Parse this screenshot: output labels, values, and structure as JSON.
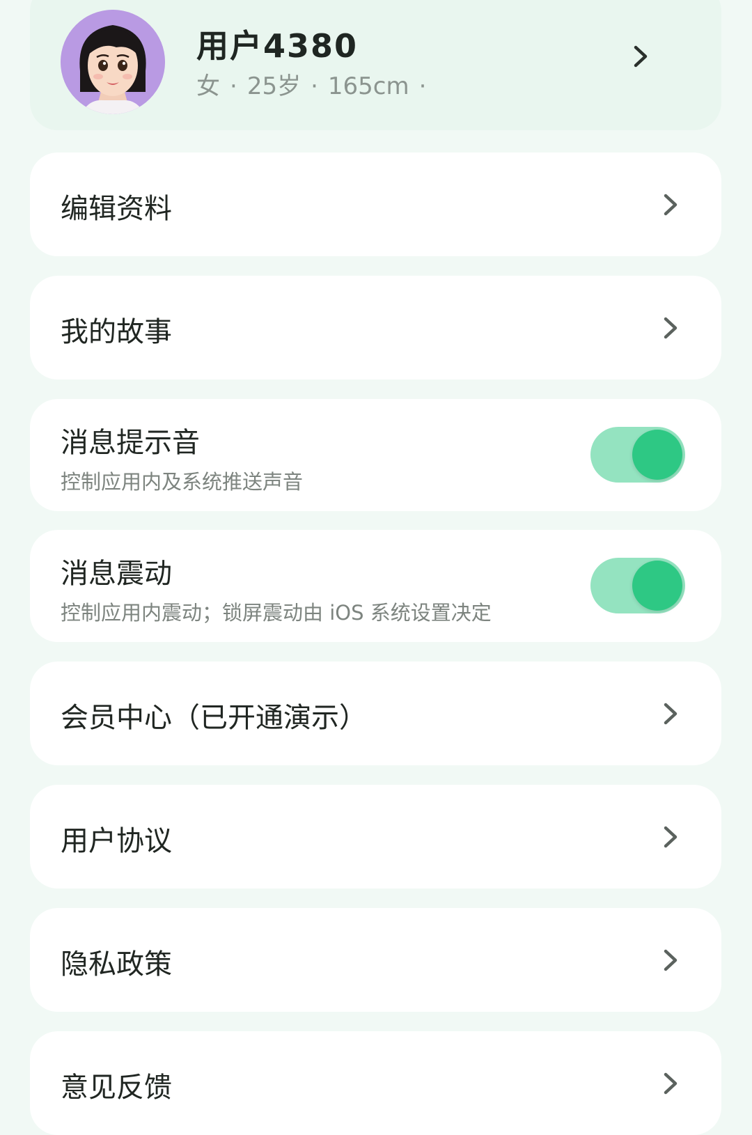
{
  "profile": {
    "name": "用户4380",
    "gender": "女",
    "age": "25岁",
    "height": "165cm",
    "separator": "·"
  },
  "menu": {
    "edit_profile": "编辑资料",
    "my_story": "我的故事",
    "notification_sound": {
      "label": "消息提示音",
      "description": "控制应用内及系统推送声音",
      "enabled": true
    },
    "notification_vibration": {
      "label": "消息震动",
      "description": "控制应用内震动；锁屏震动由 iOS 系统设置决定",
      "enabled": true
    },
    "membership": "会员中心（已开通演示）",
    "user_agreement": "用户协议",
    "privacy_policy": "隐私政策",
    "feedback": "意见反馈"
  },
  "colors": {
    "background": "#f1f9f5",
    "profile_card": "#e9f6ef",
    "toggle_on_track": "#94e3c0",
    "toggle_on_knob": "#2ec884"
  }
}
